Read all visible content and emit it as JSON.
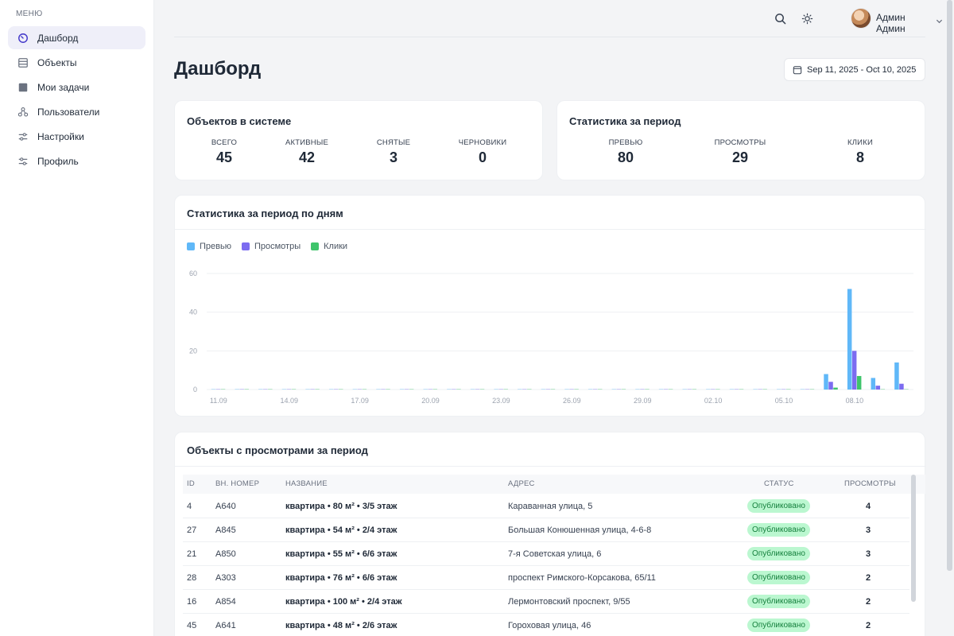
{
  "menu_title": "МЕНЮ",
  "sidebar": {
    "items": [
      {
        "label": "Дашборд",
        "icon": "dashboard-icon"
      },
      {
        "label": "Объекты",
        "icon": "list-icon"
      },
      {
        "label": "Мои задачи",
        "icon": "square-icon"
      },
      {
        "label": "Пользователи",
        "icon": "users-icon"
      },
      {
        "label": "Настройки",
        "icon": "sliders-icon"
      },
      {
        "label": "Профиль",
        "icon": "sliders-icon"
      }
    ]
  },
  "header": {
    "user_name": "Админ Админ"
  },
  "page": {
    "title": "Дашборд",
    "date_range": "Sep 11, 2025 - Oct 10, 2025"
  },
  "objects_card": {
    "title": "Объектов в системе",
    "stats": [
      {
        "label": "ВСЕГО",
        "value": "45"
      },
      {
        "label": "АКТИВНЫЕ",
        "value": "42"
      },
      {
        "label": "СНЯТЫЕ",
        "value": "3"
      },
      {
        "label": "ЧЕРНОВИКИ",
        "value": "0"
      }
    ]
  },
  "period_card": {
    "title": "Статистика за период",
    "stats": [
      {
        "label": "ПРЕВЬЮ",
        "value": "80"
      },
      {
        "label": "ПРОСМОТРЫ",
        "value": "29"
      },
      {
        "label": "КЛИКИ",
        "value": "8"
      }
    ]
  },
  "chart_card": {
    "title": "Статистика за период по дням"
  },
  "chart_data": {
    "type": "bar",
    "categories": [
      "11.09",
      "12.09",
      "13.09",
      "14.09",
      "15.09",
      "16.09",
      "17.09",
      "18.09",
      "19.09",
      "20.09",
      "21.09",
      "22.09",
      "23.09",
      "24.09",
      "25.09",
      "26.09",
      "27.09",
      "28.09",
      "29.09",
      "30.09",
      "01.10",
      "02.10",
      "03.10",
      "04.10",
      "05.10",
      "06.10",
      "07.10",
      "08.10",
      "09.10",
      "10.10"
    ],
    "tick_labels": [
      "11.09",
      "14.09",
      "17.09",
      "20.09",
      "23.09",
      "26.09",
      "29.09",
      "02.10",
      "05.10",
      "08.10"
    ],
    "series": [
      {
        "name": "Превью",
        "color": "#60b8f8",
        "values": [
          0,
          0,
          0,
          0,
          0,
          0,
          0,
          0,
          0,
          0,
          0,
          0,
          0,
          0,
          0,
          0,
          0,
          0,
          0,
          0,
          0,
          0,
          0,
          0,
          0,
          0,
          8,
          52,
          6,
          14
        ]
      },
      {
        "name": "Просмотры",
        "color": "#7c6cf0",
        "values": [
          0,
          0,
          0,
          0,
          0,
          0,
          0,
          0,
          0,
          0,
          0,
          0,
          0,
          0,
          0,
          0,
          0,
          0,
          0,
          0,
          0,
          0,
          0,
          0,
          0,
          0,
          4,
          20,
          2,
          3
        ]
      },
      {
        "name": "Клики",
        "color": "#3fc46b",
        "values": [
          0,
          0,
          0,
          0,
          0,
          0,
          0,
          0,
          0,
          0,
          0,
          0,
          0,
          0,
          0,
          0,
          0,
          0,
          0,
          0,
          0,
          0,
          0,
          0,
          0,
          0,
          1,
          7,
          0,
          0
        ]
      }
    ],
    "ylim": [
      0,
      60
    ],
    "yticks": [
      0,
      20,
      40,
      60
    ],
    "grid": true,
    "legend": "top-left"
  },
  "table_card": {
    "title": "Объекты с просмотрами за период",
    "columns": [
      "ID",
      "ВН. НОМЕР",
      "НАЗВАНИЕ",
      "АДРЕС",
      "СТАТУС",
      "ПРОСМОТРЫ"
    ],
    "rows": [
      {
        "id": "4",
        "num": "A640",
        "name": "квартира • 80 м² • 3/5 этаж",
        "address": "Караванная улица, 5",
        "status": "Опубликовано",
        "views": "4"
      },
      {
        "id": "27",
        "num": "A845",
        "name": "квартира • 54 м² • 2/4 этаж",
        "address": "Большая Конюшенная улица, 4-6-8",
        "status": "Опубликовано",
        "views": "3"
      },
      {
        "id": "21",
        "num": "A850",
        "name": "квартира • 55 м² • 6/6 этаж",
        "address": "7-я Советская улица, 6",
        "status": "Опубликовано",
        "views": "3"
      },
      {
        "id": "28",
        "num": "A303",
        "name": "квартира • 76 м² • 6/6 этаж",
        "address": "проспект Римского-Корсакова, 65/11",
        "status": "Опубликовано",
        "views": "2"
      },
      {
        "id": "16",
        "num": "A854",
        "name": "квартира • 100 м² • 2/4 этаж",
        "address": "Лермонтовский проспект, 9/55",
        "status": "Опубликовано",
        "views": "2"
      },
      {
        "id": "45",
        "num": "A641",
        "name": "квартира • 48 м² • 2/6 этаж",
        "address": "Гороховая улица, 46",
        "status": "Опубликовано",
        "views": "2"
      }
    ]
  }
}
